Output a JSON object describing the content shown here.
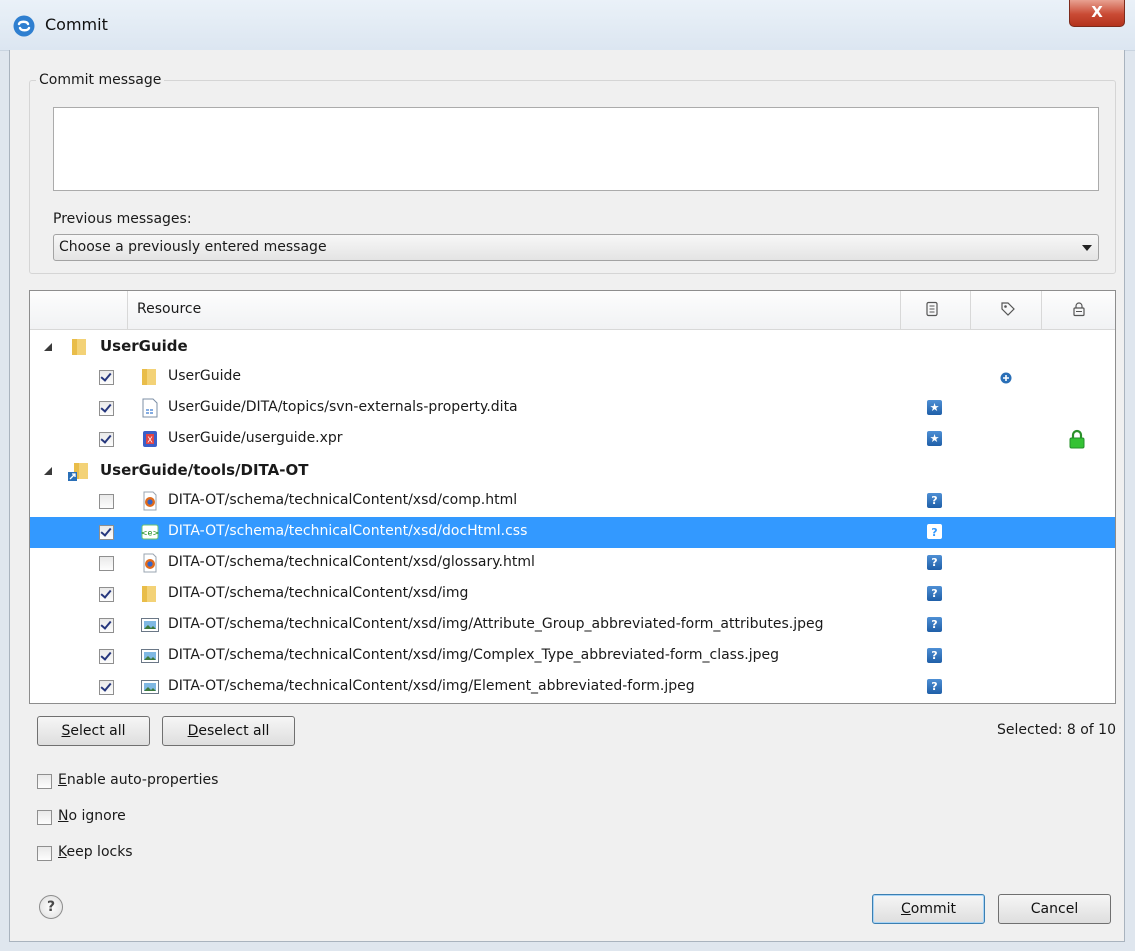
{
  "window": {
    "title": "Commit",
    "close_glyph": "X"
  },
  "commit_message": {
    "group_label": "Commit message",
    "text": "",
    "previous_label": "Previous messages:",
    "previous_selected": "Choose a previously entered message"
  },
  "table": {
    "headers": {
      "resource": "Resource"
    },
    "groups": [
      {
        "label": "UserGuide",
        "items": [
          {
            "checked": true,
            "icon": "folder-icon",
            "name": "UserGuide",
            "status": "added-icon"
          },
          {
            "checked": true,
            "icon": "dita-file-icon",
            "name": "UserGuide/DITA/topics/svn-externals-property.dita",
            "status": "modified-icon"
          },
          {
            "checked": true,
            "icon": "xpr-file-icon",
            "name": "UserGuide/userguide.xpr",
            "status": "modified-icon",
            "lock": "lock-icon"
          }
        ]
      },
      {
        "label": "UserGuide/tools/DITA-OT",
        "items": [
          {
            "checked": false,
            "icon": "html-file-icon",
            "name": "DITA-OT/schema/technicalContent/xsd/comp.html",
            "status": "unversioned-icon"
          },
          {
            "checked": true,
            "icon": "css-file-icon",
            "name": "DITA-OT/schema/technicalContent/xsd/docHtml.css",
            "status": "unversioned-icon",
            "selected": true
          },
          {
            "checked": false,
            "icon": "html-file-icon",
            "name": "DITA-OT/schema/technicalContent/xsd/glossary.html",
            "status": "unversioned-icon"
          },
          {
            "checked": true,
            "icon": "folder-icon",
            "name": "DITA-OT/schema/technicalContent/xsd/img",
            "status": "unversioned-icon"
          },
          {
            "checked": true,
            "icon": "image-file-icon",
            "name": "DITA-OT/schema/technicalContent/xsd/img/Attribute_Group_abbreviated-form_attributes.jpeg",
            "status": "unversioned-icon"
          },
          {
            "checked": true,
            "icon": "image-file-icon",
            "name": "DITA-OT/schema/technicalContent/xsd/img/Complex_Type_abbreviated-form_class.jpeg",
            "status": "unversioned-icon"
          },
          {
            "checked": true,
            "icon": "image-file-icon",
            "name": "DITA-OT/schema/technicalContent/xsd/img/Element_abbreviated-form.jpeg",
            "status": "unversioned-icon"
          }
        ]
      }
    ]
  },
  "buttons": {
    "select_all_prefix": "S",
    "select_all_rest": "elect all",
    "deselect_all_prefix": "D",
    "deselect_all_rest": "eselect all",
    "commit_prefix": "C",
    "commit_rest": "ommit",
    "cancel": "Cancel"
  },
  "selected_count": "Selected: 8 of 10",
  "options": [
    {
      "label_prefix": "E",
      "label_rest": "nable auto-properties",
      "checked": false
    },
    {
      "label_prefix": "N",
      "label_rest": "o ignore",
      "checked": false
    },
    {
      "label_prefix": "K",
      "label_rest": "eep locks",
      "checked": false
    }
  ],
  "colors": {
    "selection": "#3399ff",
    "status_blue": "#1f5fa8",
    "lock_green": "#2db52d"
  }
}
